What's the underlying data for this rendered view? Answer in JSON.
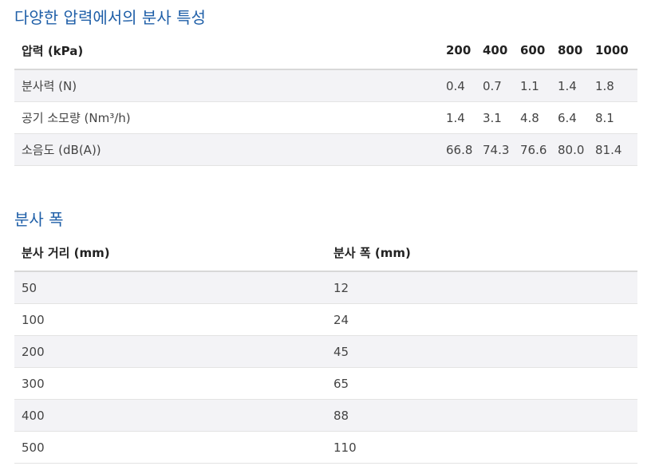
{
  "pressure_section": {
    "title": "다양한 압력에서의 분사 특성",
    "header": [
      "압력 (kPa)",
      "200",
      "400",
      "600",
      "800",
      "1000"
    ],
    "rows": [
      [
        "분사력 (N)",
        "0.4",
        "0.7",
        "1.1",
        "1.4",
        "1.8"
      ],
      [
        "공기 소모량 (Nm³/h)",
        "1.4",
        "3.1",
        "4.8",
        "6.4",
        "8.1"
      ],
      [
        "소음도 (dB(A))",
        "66.8",
        "74.3",
        "76.6",
        "80.0",
        "81.4"
      ]
    ]
  },
  "width_section": {
    "title": "분사 폭",
    "header": [
      "분사 거리 (mm)",
      "분사 폭 (mm)"
    ],
    "rows": [
      [
        "50",
        "12"
      ],
      [
        "100",
        "24"
      ],
      [
        "200",
        "45"
      ],
      [
        "300",
        "65"
      ],
      [
        "400",
        "88"
      ],
      [
        "500",
        "110"
      ]
    ]
  }
}
